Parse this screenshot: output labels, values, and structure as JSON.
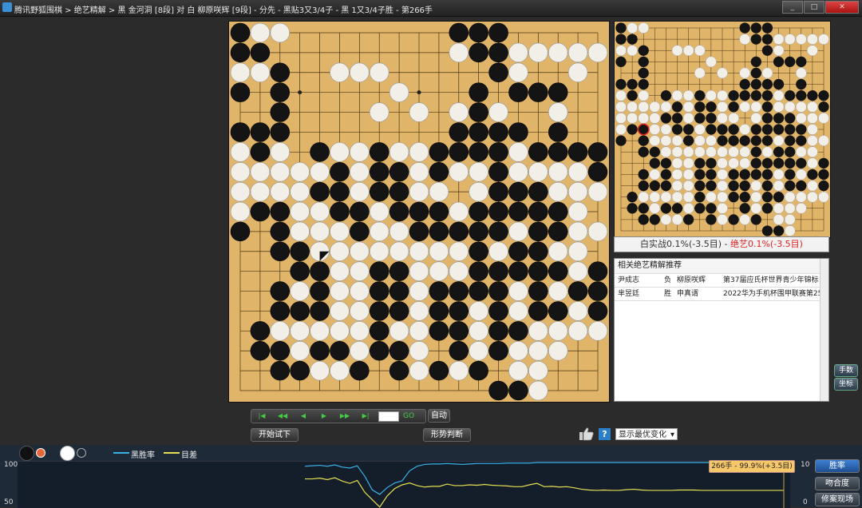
{
  "titlebar": {
    "text": "腾讯野狐围棋 > 绝艺精解 > 黑 金河洞 [8段] 对 白 柳原咲辉 [9段] - 分先 - 黑贴3又3/4子 - 黑 1又3/4子胜 - 第266手",
    "minimize": "_",
    "maximize": "□",
    "close": "✕"
  },
  "board": {
    "size": 19,
    "black": [
      [
        0,
        0
      ],
      [
        11,
        0
      ],
      [
        12,
        0
      ],
      [
        13,
        0
      ],
      [
        0,
        1
      ],
      [
        1,
        1
      ],
      [
        12,
        1
      ],
      [
        13,
        1
      ],
      [
        2,
        2
      ],
      [
        13,
        2
      ],
      [
        0,
        3
      ],
      [
        2,
        3
      ],
      [
        12,
        3
      ],
      [
        14,
        3
      ],
      [
        15,
        3
      ],
      [
        16,
        3
      ],
      [
        2,
        4
      ],
      [
        12,
        4
      ],
      [
        0,
        5
      ],
      [
        1,
        5
      ],
      [
        2,
        5
      ],
      [
        11,
        5
      ],
      [
        12,
        5
      ],
      [
        13,
        5
      ],
      [
        14,
        5
      ],
      [
        16,
        5
      ],
      [
        1,
        6
      ],
      [
        4,
        6
      ],
      [
        7,
        6
      ],
      [
        10,
        6
      ],
      [
        11,
        6
      ],
      [
        12,
        6
      ],
      [
        13,
        6
      ],
      [
        15,
        6
      ],
      [
        16,
        6
      ],
      [
        17,
        6
      ],
      [
        18,
        6
      ],
      [
        5,
        7
      ],
      [
        7,
        7
      ],
      [
        8,
        7
      ],
      [
        10,
        7
      ],
      [
        13,
        7
      ],
      [
        18,
        7
      ],
      [
        4,
        8
      ],
      [
        5,
        8
      ],
      [
        7,
        8
      ],
      [
        8,
        8
      ],
      [
        13,
        8
      ],
      [
        14,
        8
      ],
      [
        15,
        8
      ],
      [
        1,
        9
      ],
      [
        2,
        9
      ],
      [
        5,
        9
      ],
      [
        6,
        9
      ],
      [
        8,
        9
      ],
      [
        9,
        9
      ],
      [
        10,
        9
      ],
      [
        12,
        9
      ],
      [
        13,
        9
      ],
      [
        14,
        9
      ],
      [
        15,
        9
      ],
      [
        16,
        9
      ],
      [
        0,
        10
      ],
      [
        2,
        10
      ],
      [
        6,
        10
      ],
      [
        9,
        10
      ],
      [
        10,
        10
      ],
      [
        11,
        10
      ],
      [
        12,
        10
      ],
      [
        13,
        10
      ],
      [
        15,
        10
      ],
      [
        16,
        10
      ],
      [
        2,
        11
      ],
      [
        3,
        11
      ],
      [
        12,
        11
      ],
      [
        14,
        11
      ],
      [
        15,
        11
      ],
      [
        3,
        12
      ],
      [
        4,
        12
      ],
      [
        7,
        12
      ],
      [
        8,
        12
      ],
      [
        12,
        12
      ],
      [
        13,
        12
      ],
      [
        14,
        12
      ],
      [
        15,
        12
      ],
      [
        16,
        12
      ],
      [
        18,
        12
      ],
      [
        2,
        13
      ],
      [
        4,
        13
      ],
      [
        7,
        13
      ],
      [
        8,
        13
      ],
      [
        10,
        13
      ],
      [
        11,
        13
      ],
      [
        12,
        13
      ],
      [
        13,
        13
      ],
      [
        15,
        13
      ],
      [
        17,
        13
      ],
      [
        18,
        13
      ],
      [
        2,
        14
      ],
      [
        3,
        14
      ],
      [
        4,
        14
      ],
      [
        7,
        14
      ],
      [
        8,
        14
      ],
      [
        10,
        14
      ],
      [
        11,
        14
      ],
      [
        13,
        14
      ],
      [
        15,
        14
      ],
      [
        16,
        14
      ],
      [
        18,
        14
      ],
      [
        1,
        15
      ],
      [
        7,
        15
      ],
      [
        10,
        15
      ],
      [
        11,
        15
      ],
      [
        13,
        15
      ],
      [
        14,
        15
      ],
      [
        1,
        16
      ],
      [
        2,
        16
      ],
      [
        4,
        16
      ],
      [
        5,
        16
      ],
      [
        7,
        16
      ],
      [
        8,
        16
      ],
      [
        11,
        16
      ],
      [
        13,
        16
      ],
      [
        2,
        17
      ],
      [
        3,
        17
      ],
      [
        6,
        17
      ],
      [
        8,
        17
      ],
      [
        10,
        17
      ],
      [
        12,
        17
      ],
      [
        13,
        18
      ],
      [
        14,
        18
      ]
    ],
    "white": [
      [
        1,
        0
      ],
      [
        2,
        0
      ],
      [
        11,
        1
      ],
      [
        14,
        1
      ],
      [
        15,
        1
      ],
      [
        16,
        1
      ],
      [
        17,
        1
      ],
      [
        18,
        1
      ],
      [
        0,
        2
      ],
      [
        1,
        2
      ],
      [
        5,
        2
      ],
      [
        6,
        2
      ],
      [
        7,
        2
      ],
      [
        14,
        2
      ],
      [
        17,
        2
      ],
      [
        8,
        3
      ],
      [
        16,
        4
      ],
      [
        7,
        4
      ],
      [
        9,
        4
      ],
      [
        11,
        4
      ],
      [
        16,
        4
      ],
      [
        13,
        4
      ],
      [
        0,
        6
      ],
      [
        2,
        6
      ],
      [
        5,
        6
      ],
      [
        6,
        6
      ],
      [
        8,
        6
      ],
      [
        9,
        6
      ],
      [
        14,
        6
      ],
      [
        0,
        7
      ],
      [
        1,
        7
      ],
      [
        2,
        7
      ],
      [
        3,
        7
      ],
      [
        4,
        7
      ],
      [
        6,
        7
      ],
      [
        9,
        7
      ],
      [
        11,
        7
      ],
      [
        12,
        7
      ],
      [
        14,
        7
      ],
      [
        15,
        7
      ],
      [
        16,
        7
      ],
      [
        17,
        7
      ],
      [
        0,
        8
      ],
      [
        1,
        8
      ],
      [
        2,
        8
      ],
      [
        3,
        8
      ],
      [
        6,
        8
      ],
      [
        9,
        8
      ],
      [
        10,
        8
      ],
      [
        12,
        8
      ],
      [
        16,
        8
      ],
      [
        17,
        8
      ],
      [
        18,
        8
      ],
      [
        0,
        9
      ],
      [
        3,
        9
      ],
      [
        4,
        9
      ],
      [
        7,
        9
      ],
      [
        11,
        9
      ],
      [
        17,
        9
      ],
      [
        3,
        10
      ],
      [
        4,
        10
      ],
      [
        5,
        10
      ],
      [
        7,
        10
      ],
      [
        8,
        10
      ],
      [
        14,
        10
      ],
      [
        17,
        10
      ],
      [
        18,
        10
      ],
      [
        4,
        11
      ],
      [
        5,
        11
      ],
      [
        6,
        11
      ],
      [
        7,
        11
      ],
      [
        8,
        11
      ],
      [
        9,
        11
      ],
      [
        10,
        11
      ],
      [
        11,
        11
      ],
      [
        13,
        11
      ],
      [
        16,
        11
      ],
      [
        17,
        11
      ],
      [
        5,
        12
      ],
      [
        6,
        12
      ],
      [
        9,
        12
      ],
      [
        10,
        12
      ],
      [
        11,
        12
      ],
      [
        17,
        12
      ],
      [
        3,
        13
      ],
      [
        5,
        13
      ],
      [
        6,
        13
      ],
      [
        9,
        13
      ],
      [
        14,
        13
      ],
      [
        16,
        13
      ],
      [
        5,
        14
      ],
      [
        6,
        14
      ],
      [
        9,
        14
      ],
      [
        12,
        14
      ],
      [
        14,
        14
      ],
      [
        17,
        14
      ],
      [
        2,
        15
      ],
      [
        3,
        15
      ],
      [
        4,
        15
      ],
      [
        5,
        15
      ],
      [
        6,
        15
      ],
      [
        8,
        15
      ],
      [
        9,
        15
      ],
      [
        12,
        15
      ],
      [
        15,
        15
      ],
      [
        16,
        15
      ],
      [
        17,
        15
      ],
      [
        18,
        15
      ],
      [
        3,
        16
      ],
      [
        6,
        16
      ],
      [
        9,
        16
      ],
      [
        12,
        16
      ],
      [
        14,
        16
      ],
      [
        15,
        16
      ],
      [
        16,
        16
      ],
      [
        4,
        17
      ],
      [
        5,
        17
      ],
      [
        9,
        17
      ],
      [
        11,
        17
      ],
      [
        14,
        17
      ],
      [
        15,
        17
      ],
      [
        15,
        18
      ]
    ],
    "last_move": [
      4,
      11
    ]
  },
  "mini_board": {
    "marked": [
      2,
      9
    ]
  },
  "status": {
    "left": "白实战0.1%(-3.5目)",
    "sep": " - ",
    "right": "绝艺0.1%(-3.5目)",
    "right_color": "#d22222"
  },
  "list": {
    "title": "相关绝艺精解推荐",
    "rows": [
      {
        "player1": "尹成志",
        "result": "负",
        "player2": "柳原咲辉",
        "event": "第37届应氏杯世界青少年锦标"
      },
      {
        "player1": "芈昱廷",
        "result": "胜",
        "player2": "申真谞",
        "event": "2022华为手机杯围甲联赛第25"
      }
    ]
  },
  "side_buttons": {
    "moves": "手数",
    "coords": "坐标"
  },
  "controls": {
    "nav": [
      "|◀",
      "◀◀",
      "◀",
      "▶",
      "▶▶",
      "▶|"
    ],
    "go": "GO",
    "auto": "自动",
    "trial": "开始试下",
    "judge": "形势判断",
    "help": "?",
    "dropdown": "显示最优变化"
  },
  "bottom": {
    "legend_black": "黑胜率",
    "legend_diff": "目差",
    "legend_black_color": "#3ab0e6",
    "legend_diff_color": "#e6df52",
    "tooltip": "266手 - 99.9%(+3.5目)",
    "y_left_top": "100",
    "y_left_mid": "50",
    "y_right_top": "10",
    "y_right_mid": "0",
    "buttons": [
      "胜率",
      "吻合度",
      "修案现场"
    ]
  },
  "chart_data": {
    "type": "line",
    "title": "",
    "ylim": [
      0,
      100
    ],
    "series": [
      {
        "name": "黑胜率",
        "values": [
          92,
          93,
          94,
          92,
          95,
          90,
          88,
          93,
          70,
          40,
          30,
          45,
          55,
          60,
          82,
          92,
          96,
          97,
          97,
          98,
          97,
          96,
          97,
          98,
          98,
          98,
          98,
          99,
          99,
          99,
          99,
          100,
          100,
          100,
          100,
          100,
          100,
          100,
          100,
          100,
          100,
          100,
          100,
          100,
          100,
          100,
          100,
          100,
          100,
          100,
          100,
          100,
          100,
          100,
          100,
          100,
          100,
          100,
          100,
          100,
          100,
          100,
          100,
          100,
          99.9
        ]
      },
      {
        "name": "目差",
        "values": [
          6.6,
          6.6,
          6.8,
          6.4,
          6.9,
          6,
          5.4,
          6.2,
          3,
          1,
          -1,
          2,
          4,
          5,
          5.5,
          4.8,
          4.4,
          4.6,
          4.6,
          5.2,
          4.8,
          4.8,
          5.0,
          4.9,
          5.1,
          4.9,
          4.8,
          4.7,
          4.5,
          4.5,
          5,
          5.4,
          4.5,
          4.6,
          4.4,
          4.5,
          4.2,
          3.8,
          3.6,
          3.5,
          3.6,
          3.5,
          3.5,
          3.7,
          3.8,
          3.6,
          3.5,
          3.5,
          3.5,
          3.5,
          3.6,
          3.6,
          3.6,
          3.5,
          3.5,
          3.5,
          3.5,
          3.5,
          3.5,
          3.5,
          3.5,
          3.5,
          3.5,
          3.5,
          3.5
        ]
      }
    ]
  }
}
